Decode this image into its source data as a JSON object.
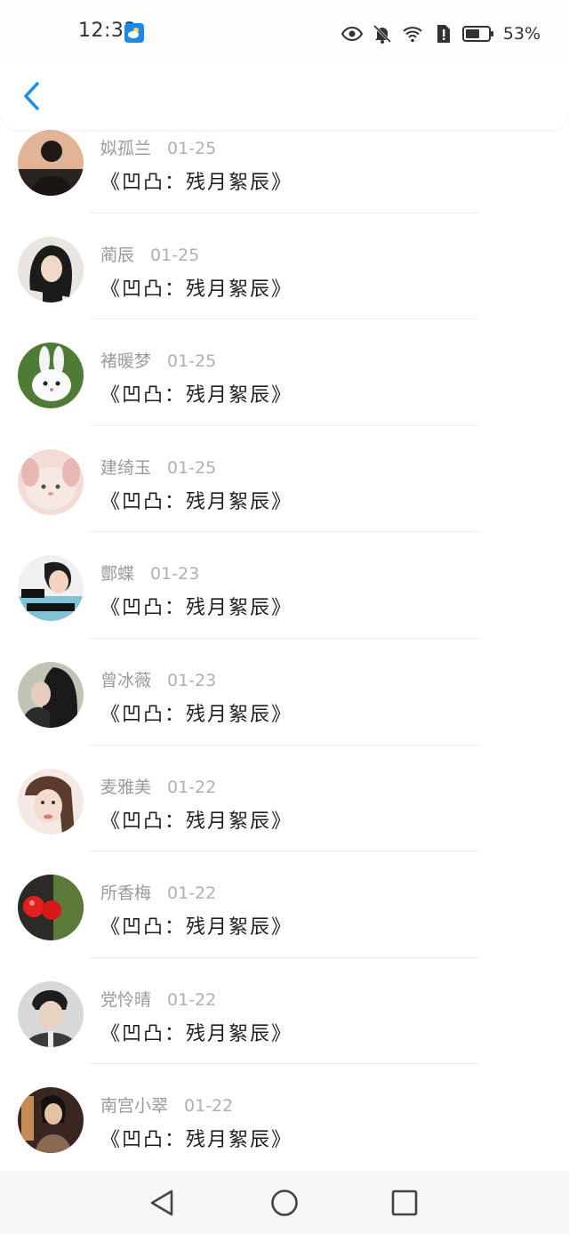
{
  "status_bar": {
    "time": "12:33",
    "battery_percent": "53%"
  },
  "header": {
    "back_icon": "chevron-left-icon"
  },
  "items": [
    {
      "name": "姒孤兰",
      "date": "01-25",
      "title": "《凹凸：残月絮辰》"
    },
    {
      "name": "蔺辰",
      "date": "01-25",
      "title": "《凹凸：残月絮辰》"
    },
    {
      "name": "褚暖梦",
      "date": "01-25",
      "title": "《凹凸：残月絮辰》"
    },
    {
      "name": "建绮玉",
      "date": "01-25",
      "title": "《凹凸：残月絮辰》"
    },
    {
      "name": "酆蝶",
      "date": "01-23",
      "title": "《凹凸：残月絮辰》"
    },
    {
      "name": "曾冰薇",
      "date": "01-23",
      "title": "《凹凸：残月絮辰》"
    },
    {
      "name": "麦雅美",
      "date": "01-22",
      "title": "《凹凸：残月絮辰》"
    },
    {
      "name": "所香梅",
      "date": "01-22",
      "title": "《凹凸：残月絮辰》"
    },
    {
      "name": "党怜晴",
      "date": "01-22",
      "title": "《凹凸：残月絮辰》"
    },
    {
      "name": "南宫小翠",
      "date": "01-22",
      "title": "《凹凸：残月絮辰》"
    }
  ],
  "nav_bar": {
    "back": "triangle-back-icon",
    "home": "circle-home-icon",
    "recents": "square-recents-icon"
  },
  "colors": {
    "accent": "#1e90e8",
    "name_gray": "#9a9a9a",
    "title_dark": "#1f1f1f"
  }
}
